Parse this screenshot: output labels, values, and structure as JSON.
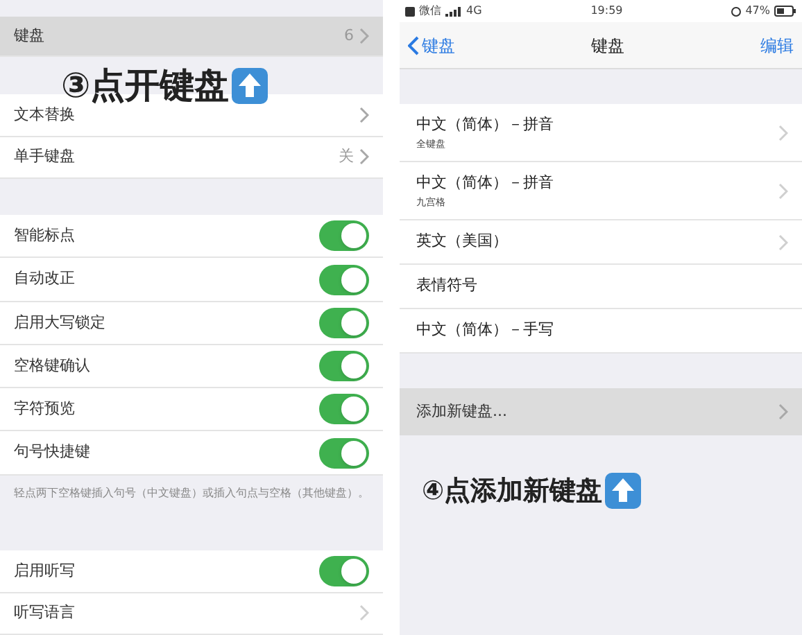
{
  "left": {
    "header_row": {
      "label": "键盘",
      "value": "6",
      "selected": true
    },
    "annotation": "③点开键盘",
    "group_1": [
      {
        "label": "文本替换"
      },
      {
        "label": "单手键盘",
        "value": "关"
      }
    ],
    "toggles": [
      {
        "label": "智能标点",
        "on": true
      },
      {
        "label": "自动改正",
        "on": true
      },
      {
        "label": "启用大写锁定",
        "on": true
      },
      {
        "label": "空格键确认",
        "on": true
      },
      {
        "label": "字符预览",
        "on": true
      },
      {
        "label": "句号快捷键",
        "on": true
      }
    ],
    "footnote": "轻点两下空格键插入句号（中文键盘）或插入句点与空格（其他键盘）。",
    "dictation": [
      {
        "kind": "toggle",
        "label": "启用听写",
        "on": true
      },
      {
        "kind": "link",
        "label": "听写语言"
      }
    ]
  },
  "right": {
    "status_bar": {
      "carrier": "微信",
      "network": "4G",
      "time": "19:59",
      "battery": "47%"
    },
    "nav": {
      "back": "键盘",
      "title": "键盘",
      "action": "编辑"
    },
    "keyboards": [
      {
        "label": "中文（简体）－拼音",
        "subtitle": "全键盘",
        "kind": "link"
      },
      {
        "label": "中文（简体）－拼音",
        "subtitle": "九宫格",
        "kind": "link"
      },
      {
        "label": "英文（美国）",
        "kind": "link"
      },
      {
        "label": "表情符号",
        "kind": "plain"
      },
      {
        "label": "中文（简体）－手写",
        "kind": "plain"
      }
    ],
    "add_row": {
      "label": "添加新键盘...",
      "selected": true
    },
    "annotation": "④点添加新键盘"
  }
}
